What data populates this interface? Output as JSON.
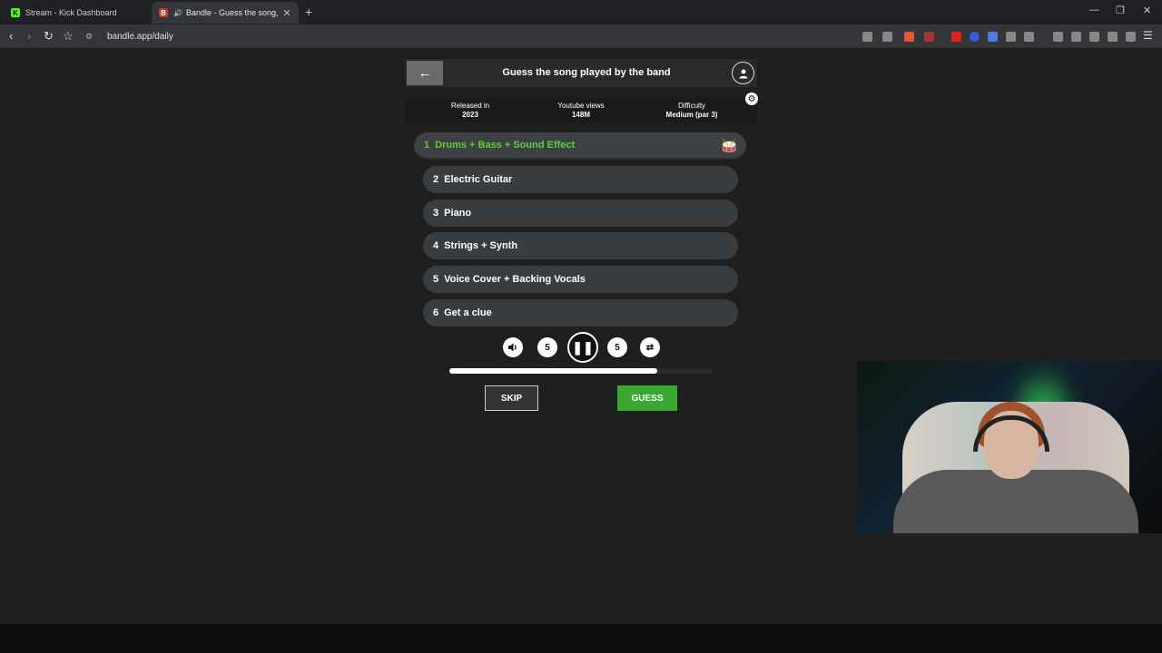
{
  "browser": {
    "tabs": [
      {
        "title": "Stream - Kick Dashboard",
        "favicon": "K"
      },
      {
        "title": "Bandle - Guess the song, one",
        "favicon": "B"
      }
    ],
    "new_tab": "+",
    "url": "bandle.app/daily",
    "window_controls": {
      "minimize": "—",
      "restore": "❐",
      "close": "✕"
    }
  },
  "app": {
    "back_label": "←",
    "title": "Guess the song played by the band",
    "info": [
      {
        "label": "Released in",
        "value": "2023"
      },
      {
        "label": "Youtube views",
        "value": "148M"
      },
      {
        "label": "Difficulty",
        "value": "Medium (par 3)"
      }
    ],
    "tracks": [
      {
        "num": "1",
        "label": "Drums + Bass + Sound Effect"
      },
      {
        "num": "2",
        "label": "Electric Guitar"
      },
      {
        "num": "3",
        "label": "Piano"
      },
      {
        "num": "4",
        "label": "Strings + Synth"
      },
      {
        "num": "5",
        "label": "Voice Cover + Backing Vocals"
      },
      {
        "num": "6",
        "label": "Get a clue"
      }
    ],
    "controls": {
      "rewind_seconds": "5",
      "forward_seconds": "5"
    },
    "progress": 0.79,
    "skip_label": "SKIP",
    "guess_label": "GUESS",
    "accent_color": "#5ecf3a",
    "guess_color": "#3aa832"
  }
}
